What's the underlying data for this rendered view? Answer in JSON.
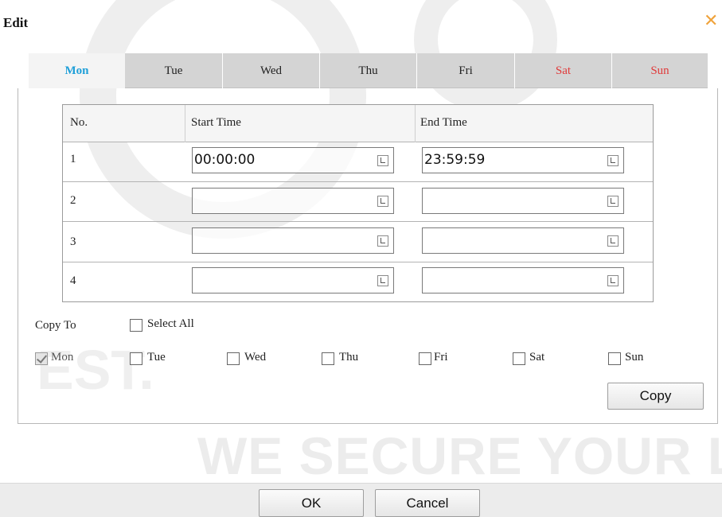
{
  "dialog": {
    "title": "Edit",
    "close_icon": "close-icon",
    "accent_color": "#f0a33c"
  },
  "tabs": [
    {
      "label": "Mon",
      "active": true
    },
    {
      "label": "Tue"
    },
    {
      "label": "Wed"
    },
    {
      "label": "Thu"
    },
    {
      "label": "Fri"
    },
    {
      "label": "Sat",
      "weekend": true
    },
    {
      "label": "Sun",
      "weekend": true
    }
  ],
  "table": {
    "headers": {
      "no": "No.",
      "start": "Start Time",
      "end": "End Time"
    },
    "rows": [
      {
        "no": "1",
        "start": "00:00:00",
        "end": "23:59:59"
      },
      {
        "no": "2",
        "start": "",
        "end": ""
      },
      {
        "no": "3",
        "start": "",
        "end": ""
      },
      {
        "no": "4",
        "start": "",
        "end": ""
      }
    ]
  },
  "copy": {
    "label": "Copy To",
    "select_all": "Select All",
    "days": [
      {
        "label": "Mon",
        "checked": true,
        "disabled": true
      },
      {
        "label": "Tue",
        "checked": false
      },
      {
        "label": "Wed",
        "checked": false
      },
      {
        "label": "Thu",
        "checked": false
      },
      {
        "label": "Fri",
        "checked": false
      },
      {
        "label": "Sat",
        "checked": false
      },
      {
        "label": "Sun",
        "checked": false
      }
    ],
    "button": "Copy"
  },
  "footer": {
    "ok": "OK",
    "cancel": "Cancel"
  },
  "watermark": {
    "text": "WE SECURE YOUR LI",
    "fragment": "EST."
  },
  "colors": {
    "active_tab": "#1f9fd8",
    "weekend": "#e03a3a"
  }
}
